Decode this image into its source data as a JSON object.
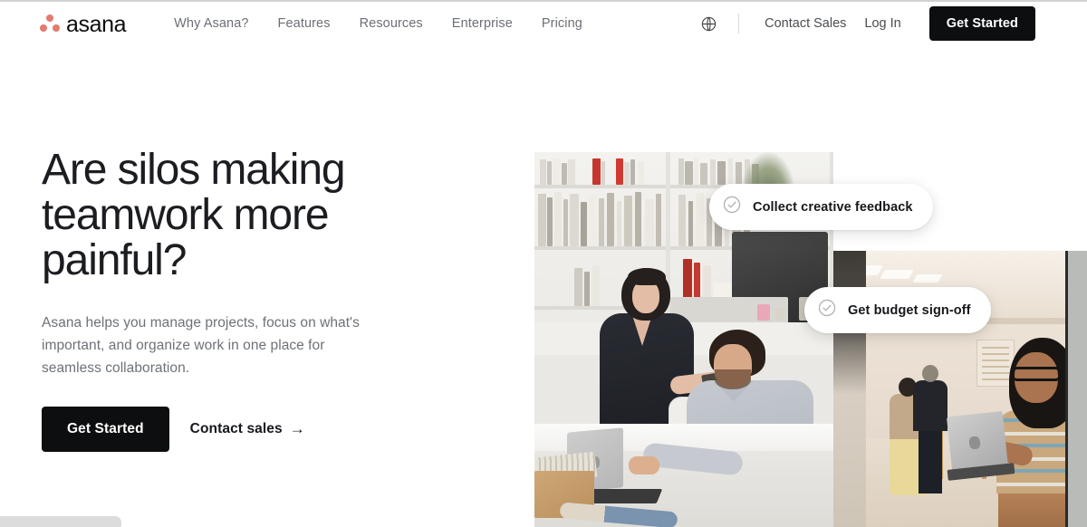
{
  "brand": {
    "name": "asana",
    "logo_icon": "asana-three-dots-logo",
    "dot_color": "#e37b6d"
  },
  "nav": {
    "links": [
      {
        "label": "Why Asana?"
      },
      {
        "label": "Features"
      },
      {
        "label": "Resources"
      },
      {
        "label": "Enterprise"
      },
      {
        "label": "Pricing"
      }
    ],
    "language_icon": "globe-icon",
    "contact_sales": "Contact Sales",
    "log_in": "Log In",
    "get_started": "Get Started"
  },
  "hero": {
    "title": "Are silos making teamwork more painful?",
    "subtitle": "Asana helps you manage projects, focus on what's important, and organize work in one place for seamless collaboration.",
    "primary_cta": "Get Started",
    "secondary_cta": "Contact sales",
    "secondary_cta_arrow": "→"
  },
  "media": {
    "chips": [
      {
        "icon": "check-circle-icon",
        "label": "Collect creative feedback"
      },
      {
        "icon": "check-circle-icon",
        "label": "Get budget sign-off"
      }
    ],
    "photos": [
      {
        "alt": "Two colleagues collaborating at a desk in a design studio"
      },
      {
        "alt": "Woman holding a laptop in an open office workspace"
      }
    ]
  },
  "colors": {
    "accent": "#e37b6d",
    "button_dark": "#0d0e10",
    "text_primary": "#1b1d21",
    "text_muted": "#6d7278",
    "nav_link": "#6b6f76"
  }
}
